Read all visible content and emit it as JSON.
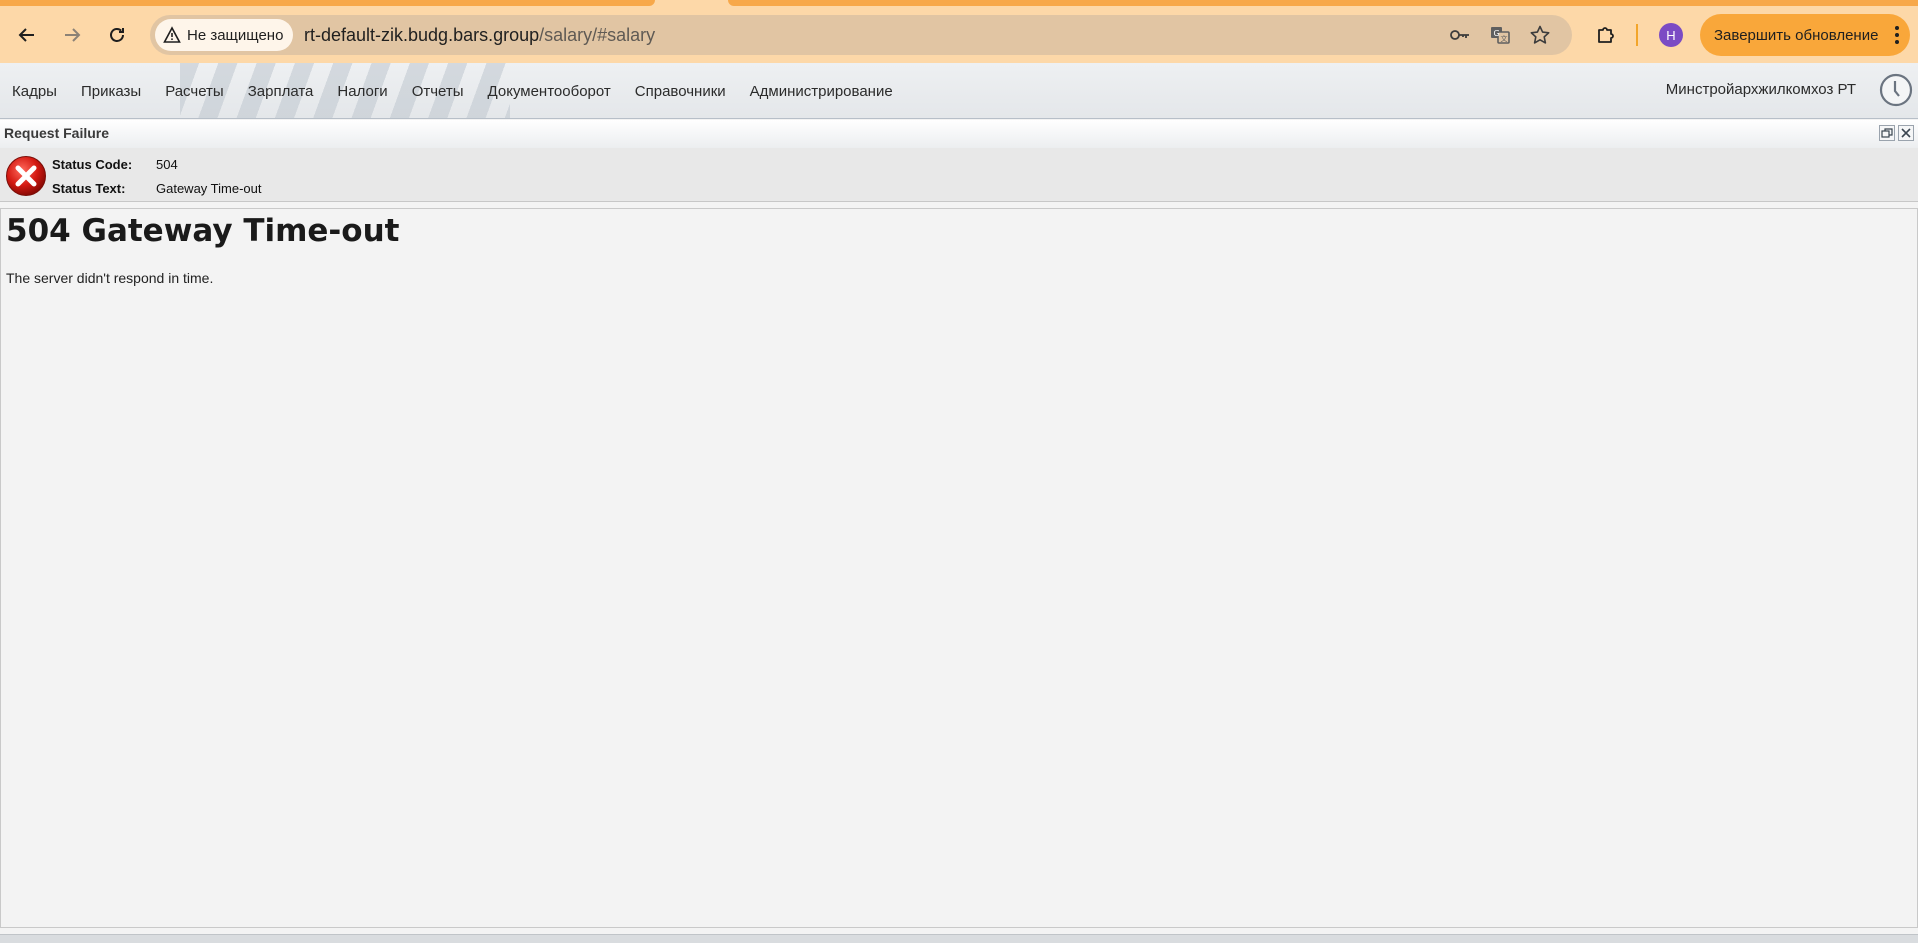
{
  "browser": {
    "security_label": "Не защищено",
    "url_host": "rt-default-zik.budg.bars.group",
    "url_path": "/salary/#salary",
    "profile_initial": "Н",
    "update_button_label": "Завершить обновление",
    "accent_color": "#f9a73a"
  },
  "app": {
    "menu": [
      "Кадры",
      "Приказы",
      "Расчеты",
      "Зарплата",
      "Налоги",
      "Отчеты",
      "Документооборот",
      "Справочники",
      "Администрирование"
    ],
    "organization": "Минстройархжилкомхоз РТ"
  },
  "error_panel": {
    "title": "Request Failure",
    "status_code_label": "Status Code:",
    "status_code": "504",
    "status_text_label": "Status Text:",
    "status_text": "Gateway Time-out",
    "heading": "504 Gateway Time-out",
    "message": "The server didn't respond in time."
  }
}
